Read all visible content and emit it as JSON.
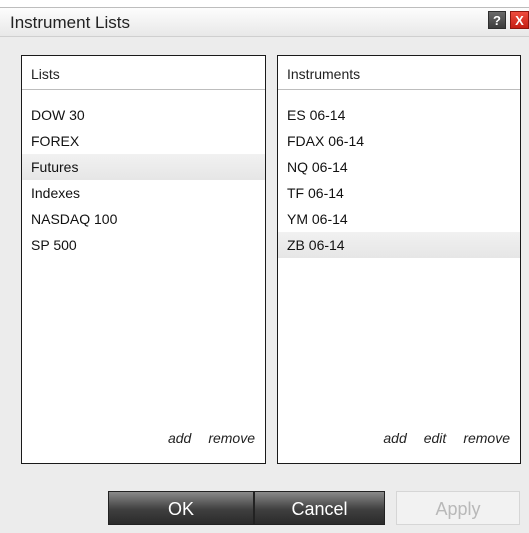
{
  "window": {
    "title": "Instrument Lists",
    "help_label": "?",
    "close_label": "X"
  },
  "lists_panel": {
    "header": "Lists",
    "items": [
      {
        "label": "DOW 30",
        "selected": false
      },
      {
        "label": "FOREX",
        "selected": false
      },
      {
        "label": "Futures",
        "selected": true
      },
      {
        "label": "Indexes",
        "selected": false
      },
      {
        "label": "NASDAQ 100",
        "selected": false
      },
      {
        "label": "SP 500",
        "selected": false
      }
    ],
    "actions": {
      "add": "add",
      "remove": "remove"
    }
  },
  "instruments_panel": {
    "header": "Instruments",
    "items": [
      {
        "label": "ES 06-14",
        "selected": false
      },
      {
        "label": "FDAX 06-14",
        "selected": false
      },
      {
        "label": "NQ 06-14",
        "selected": false
      },
      {
        "label": "TF 06-14",
        "selected": false
      },
      {
        "label": "YM 06-14",
        "selected": false
      },
      {
        "label": "ZB 06-14",
        "selected": true
      }
    ],
    "actions": {
      "add": "add",
      "edit": "edit",
      "remove": "remove"
    }
  },
  "buttons": {
    "ok": "OK",
    "cancel": "Cancel",
    "apply": "Apply",
    "apply_enabled": false
  }
}
